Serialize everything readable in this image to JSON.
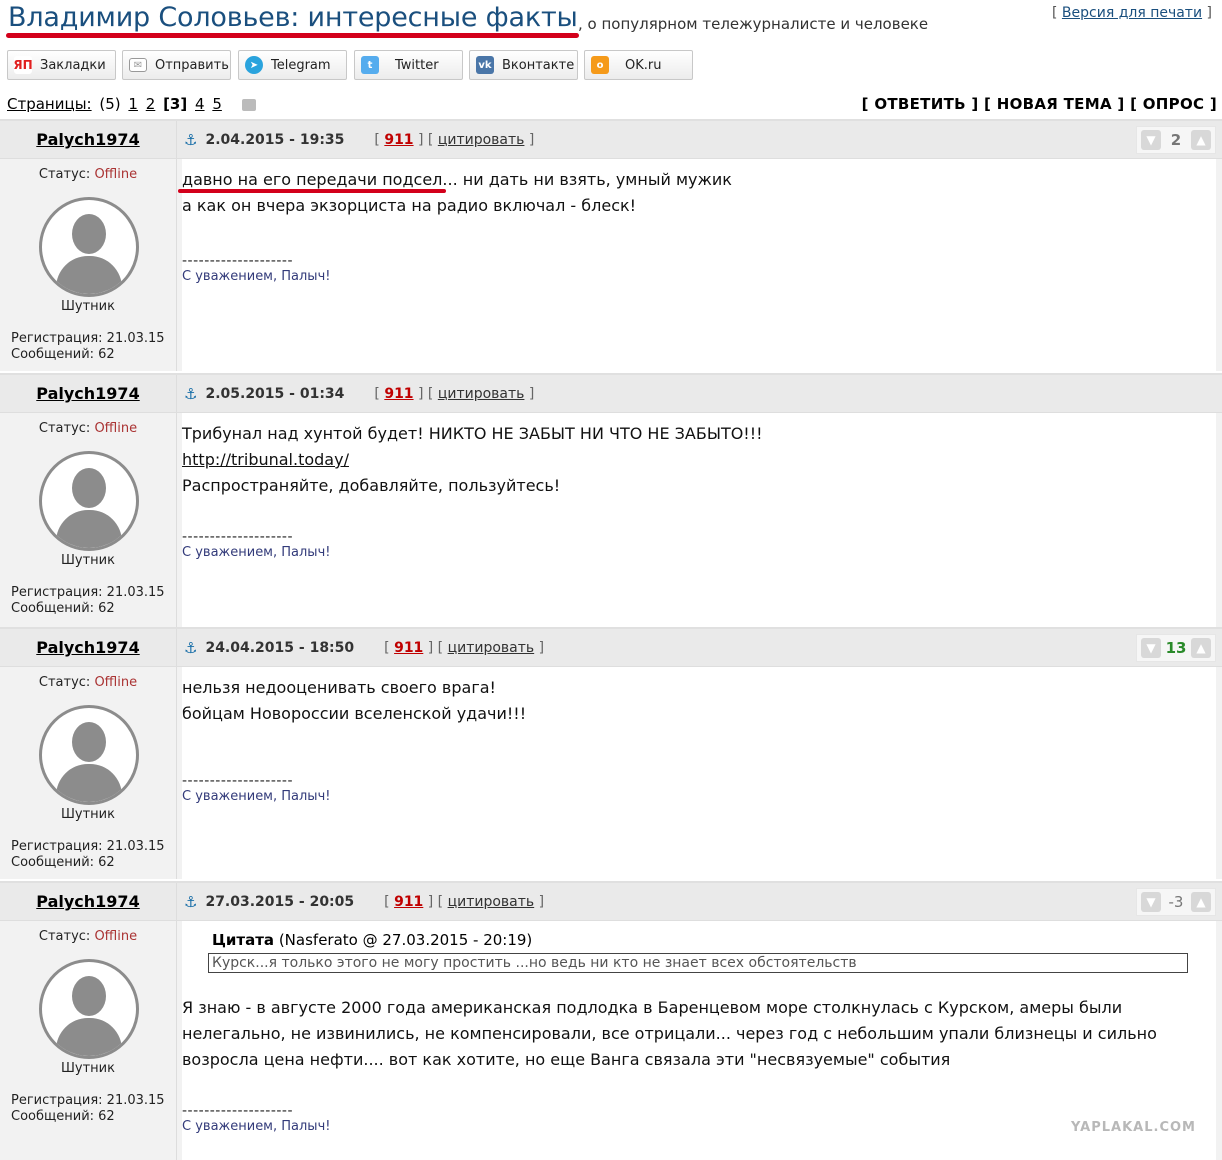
{
  "topic": {
    "title": "Владимир Соловьев: интересные факты",
    "description": ", о популярном тележурналисте и человеке",
    "print_prefix": "[ ",
    "print_link": "Версия для печати",
    "print_suffix": " ]"
  },
  "share_buttons": [
    {
      "label": "Закладки",
      "icon": "yandex-icon",
      "color": "#e02020"
    },
    {
      "label": "Отправить",
      "icon": "mail-icon",
      "color": "#999999"
    },
    {
      "label": "Telegram",
      "icon": "telegram-icon",
      "color": "#2aa3dd"
    },
    {
      "label": "Twitter",
      "icon": "twitter-icon",
      "color": "#55acee"
    },
    {
      "label": "Вконтакте",
      "icon": "vk-icon",
      "color": "#4a76a8"
    },
    {
      "label": "OK.ru",
      "icon": "ok-icon",
      "color": "#f59a1a"
    }
  ],
  "pagination": {
    "label": "Страницы:",
    "count": "(5)",
    "pages": [
      "1",
      "2",
      "[3]",
      "4",
      "5"
    ],
    "current": "3"
  },
  "actions": {
    "reply": "[ ОТВЕТИТЬ ]",
    "new_topic": "[ НОВАЯ ТЕМА ]",
    "poll": "[ ОПРОС ]"
  },
  "posts": [
    {
      "author": "Palych1974",
      "date": "2.04.2015 - 19:35",
      "n911": "911",
      "cite": "цитировать",
      "rating": "2",
      "status_label": "Статус:",
      "status": "Offline",
      "rank": "Шутник",
      "reg": "Регистрация: 21.03.15",
      "msgs": "Сообщений: 62",
      "lines": [
        "давно на его передачи подсел... ни дать ни взять, умный мужик",
        "а как он вчера экзорциста на радио включал - блеск!"
      ],
      "sig_dash": "--------------------",
      "signature": "С уважением, Палыч!"
    },
    {
      "author": "Palych1974",
      "date": "2.05.2015 - 01:34",
      "n911": "911",
      "cite": "цитировать",
      "rating": "",
      "status_label": "Статус:",
      "status": "Offline",
      "rank": "Шутник",
      "reg": "Регистрация: 21.03.15",
      "msgs": "Сообщений: 62",
      "lines": [
        "Трибунал над хунтой будет! НИКТО НЕ ЗАБЫТ НИ ЧТО НЕ ЗАБЫТО!!!",
        "http://tribunal.today/",
        "Распространяйте, добавляйте, пользуйтесь!"
      ],
      "sig_dash": "--------------------",
      "signature": "С уважением, Палыч!"
    },
    {
      "author": "Palych1974",
      "date": "24.04.2015 - 18:50",
      "n911": "911",
      "cite": "цитировать",
      "rating": "13",
      "status_label": "Статус:",
      "status": "Offline",
      "rank": "Шутник",
      "reg": "Регистрация: 21.03.15",
      "msgs": "Сообщений: 62",
      "lines": [
        "нельзя недооценивать своего врага!",
        "бойцам Новороссии вселенской удачи!!!"
      ],
      "sig_dash": "--------------------",
      "signature": "С уважением, Палыч!"
    },
    {
      "author": "Palych1974",
      "date": "27.03.2015 - 20:05",
      "n911": "911",
      "cite": "цитировать",
      "rating": "-3",
      "status_label": "Статус:",
      "status": "Offline",
      "rank": "Шутник",
      "reg": "Регистрация: 21.03.15",
      "msgs": "Сообщений: 62",
      "quote_label": "Цитата",
      "quote_source": " (Nasferato @ 27.03.2015 - 20:19)",
      "quote_text": "Курск...я только этого не могу простить ...но ведь ни кто не знает всех обстоятельств",
      "lines": [
        "Я знаю - в августе 2000 года американская подлодка в Баренцевом море столкнулась с Курском, амеры были",
        "нелегально, не извинились, не компенсировали, все отрицали... через год с небольшим упали близнецы и сильно",
        "возросла цена нефти.... вот как хотите, но еще Ванга связала эти \"несвязуемые\" события"
      ],
      "sig_dash": "--------------------",
      "signature": "С уважением, Палыч!"
    }
  ],
  "watermark": "YAPLAKAL.COM"
}
